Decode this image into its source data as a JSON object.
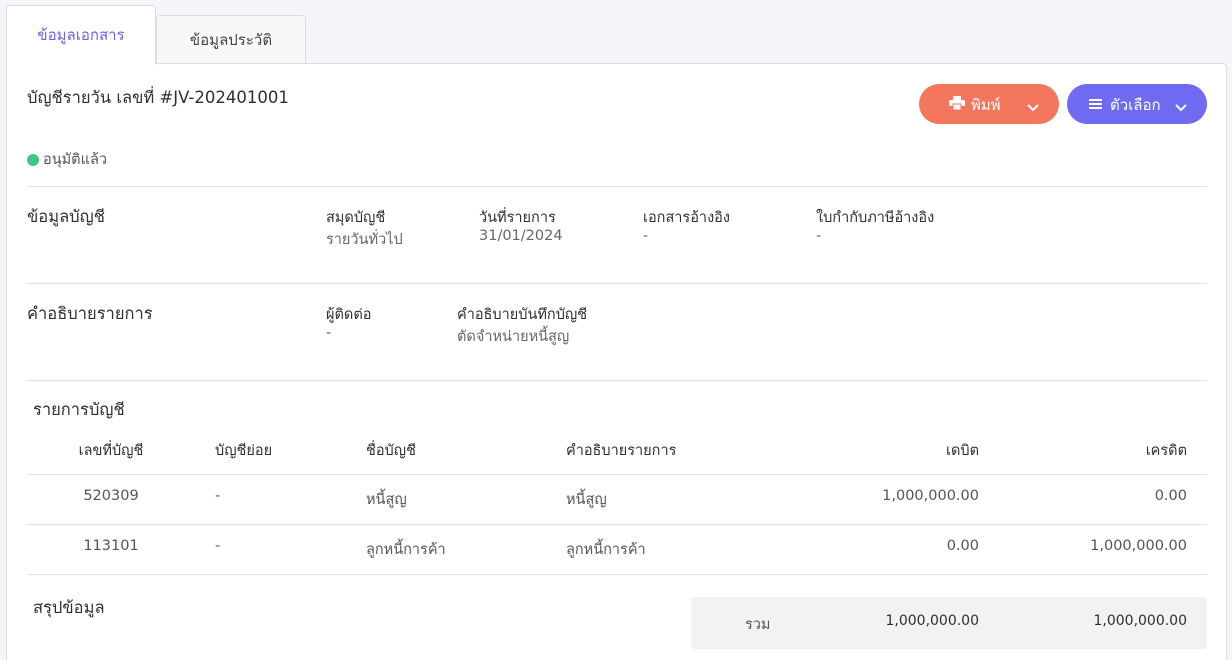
{
  "tabs": [
    {
      "label": "ข้อมูลเอกสาร",
      "active": true
    },
    {
      "label": "ข้อมูลประวัติ",
      "active": false
    }
  ],
  "header": {
    "doc_title": "บัญชีรายวัน เลขที่ #JV-202401001",
    "status": "อนุมัติแล้ว",
    "status_color": "#3fc784"
  },
  "buttons": {
    "print_label": "พิมพ์",
    "options_label": "ตัวเลือก",
    "print_color": "#f4775d",
    "options_color": "#6e6bf2"
  },
  "account_info": {
    "title": "ข้อมูลบัญชี",
    "fields": [
      {
        "label": "สมุดบัญชี",
        "value": "รายวันทั่วไป"
      },
      {
        "label": "วันที่รายการ",
        "value": "31/01/2024"
      },
      {
        "label": "เอกสารอ้างอิง",
        "value": "-"
      },
      {
        "label": "ใบกำกับภาษีอ้างอิง",
        "value": "-"
      }
    ]
  },
  "description": {
    "title": "คำอธิบายรายการ",
    "fields": [
      {
        "label": "ผู้ติดต่อ",
        "value": "-"
      },
      {
        "label": "คำอธิบายบันทึกบัญชี",
        "value": "ตัดจำหน่ายหนี้สูญ"
      }
    ]
  },
  "entries": {
    "title": "รายการบัญชี",
    "columns": [
      "เลขที่บัญชี",
      "บัญชีย่อย",
      "ชื่อบัญชี",
      "คำอธิบายรายการ",
      "เดบิต",
      "เครดิต"
    ],
    "rows": [
      {
        "account_no": "520309",
        "sub_account": "-",
        "account_name": "หนี้สูญ",
        "description": "หนี้สูญ",
        "debit": "1,000,000.00",
        "credit": "0.00"
      },
      {
        "account_no": "113101",
        "sub_account": "-",
        "account_name": "ลูกหนี้การค้า",
        "description": "ลูกหนี้การค้า",
        "debit": "0.00",
        "credit": "1,000,000.00"
      }
    ]
  },
  "summary": {
    "title": "สรุปข้อมูล",
    "total_label": "รวม",
    "total_debit": "1,000,000.00",
    "total_credit": "1,000,000.00"
  }
}
